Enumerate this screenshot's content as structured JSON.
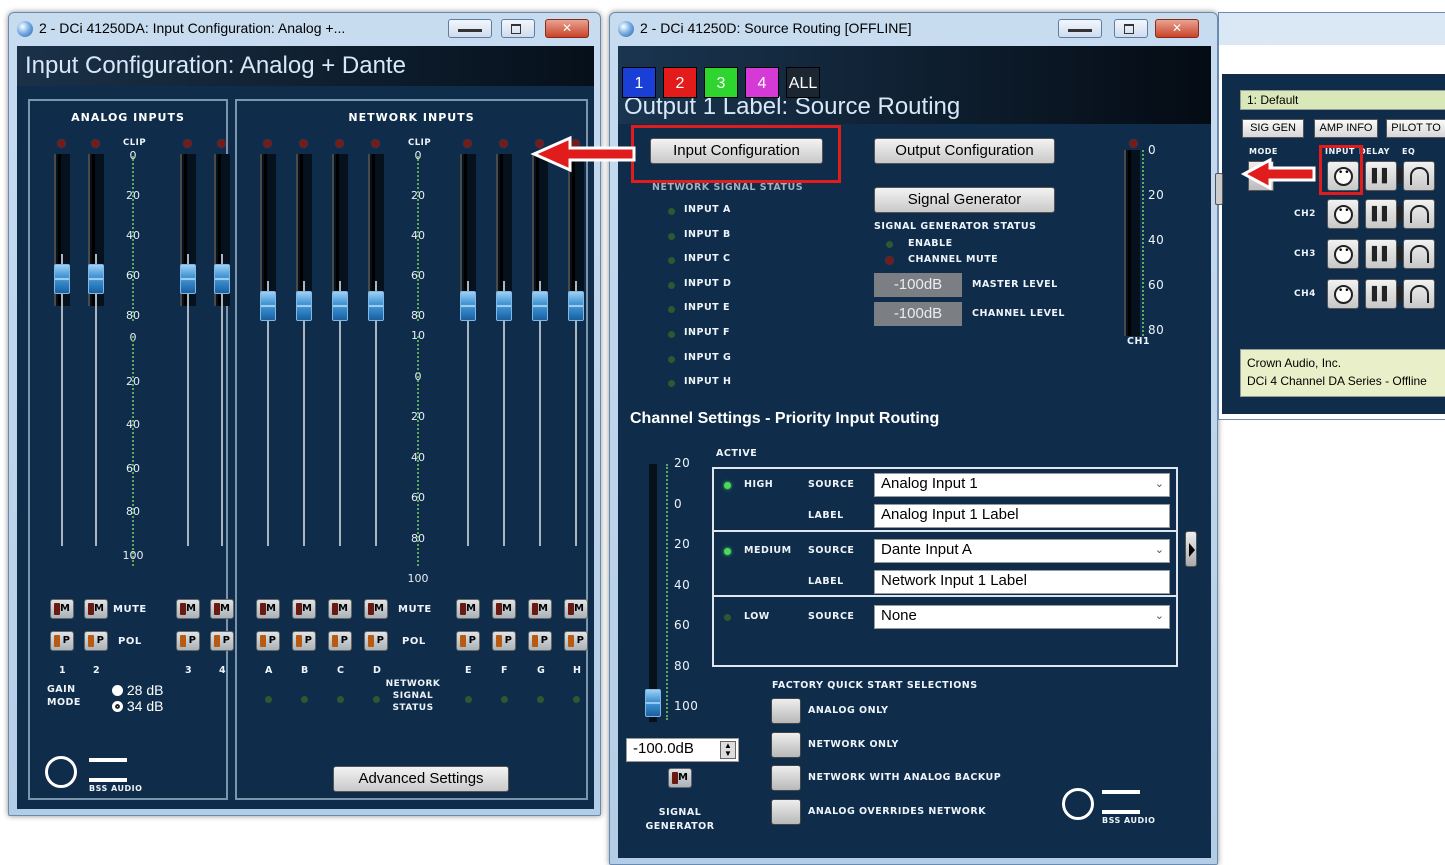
{
  "win1": {
    "title": "2 - DCi 41250DA: Input Configuration: Analog +...",
    "header": "Input Configuration: Analog + Dante",
    "analog_title": "ANALOG INPUTS",
    "network_title": "NETWORK INPUTS",
    "clip": "CLIP",
    "meter_scale": [
      "0",
      "20",
      "40",
      "60",
      "80"
    ],
    "fader_scale_analog": [
      "0",
      "20",
      "40",
      "60",
      "80",
      "100"
    ],
    "fader_scale_network": [
      "10",
      "0",
      "20",
      "40",
      "60",
      "80",
      "100"
    ],
    "mute": "MUTE",
    "pol": "POL",
    "m": "M",
    "p": "P",
    "analog_channels": [
      "1",
      "2",
      "3",
      "4"
    ],
    "network_channels": [
      "A",
      "B",
      "C",
      "D",
      "E",
      "F",
      "G",
      "H"
    ],
    "gain_mode_label": "GAIN MODE",
    "gain_options": [
      "28 dB",
      "34 dB"
    ],
    "network_signal_status": "NETWORK SIGNAL STATUS",
    "advanced_settings": "Advanced Settings",
    "logo": "BSS AUDIO"
  },
  "win2": {
    "title": "2 - DCi 41250D: Source Routing [OFFLINE]",
    "tabs": [
      {
        "label": "1",
        "color": "#1a3fd6"
      },
      {
        "label": "2",
        "color": "#e41b1b"
      },
      {
        "label": "3",
        "color": "#2fd52f"
      },
      {
        "label": "4",
        "color": "#d63ad6"
      },
      {
        "label": "ALL",
        "color": "#1c2630"
      }
    ],
    "header": "Output 1 Label: Source Routing",
    "input_config_btn": "Input Configuration",
    "output_config_btn": "Output Configuration",
    "network_signal_status": "NETWORK SIGNAL STATUS",
    "inputs": [
      "INPUT A",
      "INPUT B",
      "INPUT C",
      "INPUT D",
      "INPUT E",
      "INPUT F",
      "INPUT G",
      "INPUT H"
    ],
    "signal_gen_btn": "Signal Generator",
    "sg_status": "SIGNAL GENERATOR STATUS",
    "enable": "ENABLE",
    "channel_mute": "CHANNEL MUTE",
    "master_level_value": "-100dB",
    "master_level": "MASTER LEVEL",
    "channel_level_value": "-100dB",
    "channel_level": "CHANNEL LEVEL",
    "meter_scale": [
      "0",
      "20",
      "40",
      "60",
      "80"
    ],
    "ch_label": "CH1",
    "channel_settings": "Channel Settings - Priority Input Routing",
    "active": "ACTIVE",
    "fader_scale": [
      "20",
      "0",
      "20",
      "40",
      "60",
      "80",
      "100"
    ],
    "high": "HIGH",
    "medium": "MEDIUM",
    "low": "LOW",
    "source": "SOURCE",
    "label": "LABEL",
    "high_source": "Analog Input 1",
    "high_label": "Analog Input 1 Label",
    "medium_source": "Dante Input A",
    "medium_label": "Network Input 1 Label",
    "low_source": "None",
    "sg_value": "-100.0dB",
    "m": "M",
    "signal_generator": "SIGNAL GENERATOR",
    "factory_title": "FACTORY QUICK START SELECTIONS",
    "quick": [
      "ANALOG ONLY",
      "NETWORK ONLY",
      "NETWORK WITH ANALOG BACKUP",
      "ANALOG OVERRIDES NETWORK"
    ],
    "logo": "BSS AUDIO"
  },
  "win3": {
    "preset": "1: Default",
    "buttons": [
      "SIG GEN",
      "AMP INFO",
      "PILOT TO"
    ],
    "cols": [
      "MODE",
      "INPUT",
      "DELAY",
      "EQ"
    ],
    "rows": [
      "CH2",
      "CH3",
      "CH4"
    ],
    "company": "Crown Audio, Inc.",
    "device": "DCi 4 Channel DA Series - Offline"
  }
}
